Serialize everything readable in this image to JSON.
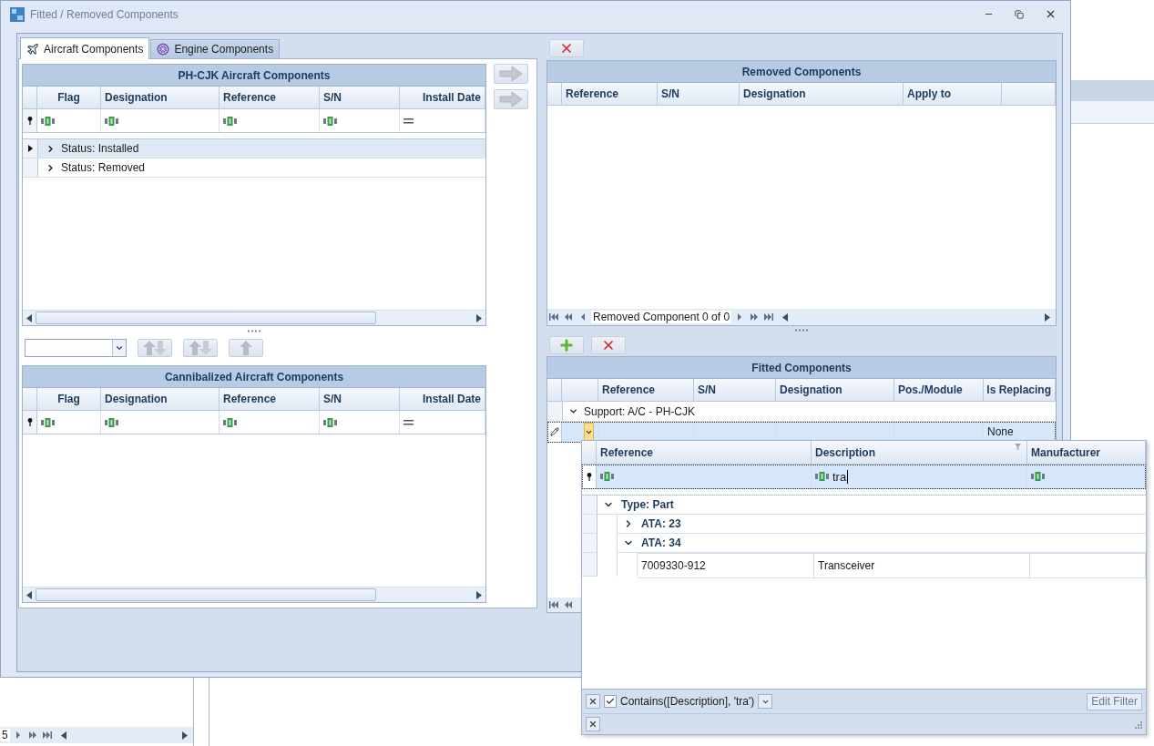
{
  "window": {
    "title": "Fitted / Removed Components"
  },
  "tabs": [
    {
      "label": "Aircraft Components",
      "selected": true
    },
    {
      "label": "Engine Components",
      "selected": false
    }
  ],
  "aircraft_grid": {
    "title": "PH-CJK Aircraft Components",
    "columns": [
      {
        "label": "Flag",
        "kind": "flag"
      },
      {
        "label": "Designation",
        "kind": "text"
      },
      {
        "label": "Reference",
        "kind": "text"
      },
      {
        "label": "S/N",
        "kind": "text"
      },
      {
        "label": "Install Date",
        "kind": "date"
      }
    ],
    "groups": [
      {
        "label": "Status: Installed",
        "expanded": false,
        "selected": true
      },
      {
        "label": "Status: Removed",
        "expanded": false,
        "selected": false
      }
    ]
  },
  "cannibalized_grid": {
    "title": "Cannibalized Aircraft Components",
    "columns": [
      {
        "label": "Flag",
        "kind": "flag"
      },
      {
        "label": "Designation",
        "kind": "text"
      },
      {
        "label": "Reference",
        "kind": "text"
      },
      {
        "label": "S/N",
        "kind": "text"
      },
      {
        "label": "Install Date",
        "kind": "date"
      }
    ]
  },
  "removed_grid": {
    "title": "Removed Components",
    "columns": [
      "Reference",
      "S/N",
      "Designation",
      "Apply to"
    ],
    "navigator": "Removed Component 0 of 0"
  },
  "fitted_grid": {
    "title": "Fitted Components",
    "columns": [
      "Reference",
      "S/N",
      "Designation",
      "Pos./Module",
      "Is Replacing"
    ],
    "groups": [
      {
        "label": "Support: A/C - PH-CJK",
        "expanded": true
      }
    ],
    "edit_row": {
      "is_replacing": "None"
    }
  },
  "lookup_popup": {
    "columns": [
      "Reference",
      "Description",
      "Manufacturer"
    ],
    "filter_values": {
      "description": "tra"
    },
    "tree": [
      {
        "label": "Type: Part",
        "expanded": true,
        "children": [
          {
            "label": "ATA: 23",
            "expanded": false
          },
          {
            "label": "ATA: 34",
            "expanded": true,
            "rows": [
              {
                "reference": "7009330-912",
                "description": "Transceiver"
              }
            ]
          }
        ]
      }
    ],
    "filter_bar": {
      "enabled": true,
      "text": "Contains([Description], 'tra')",
      "button": "Edit Filter"
    }
  },
  "background_app": {
    "page_number": "5"
  }
}
